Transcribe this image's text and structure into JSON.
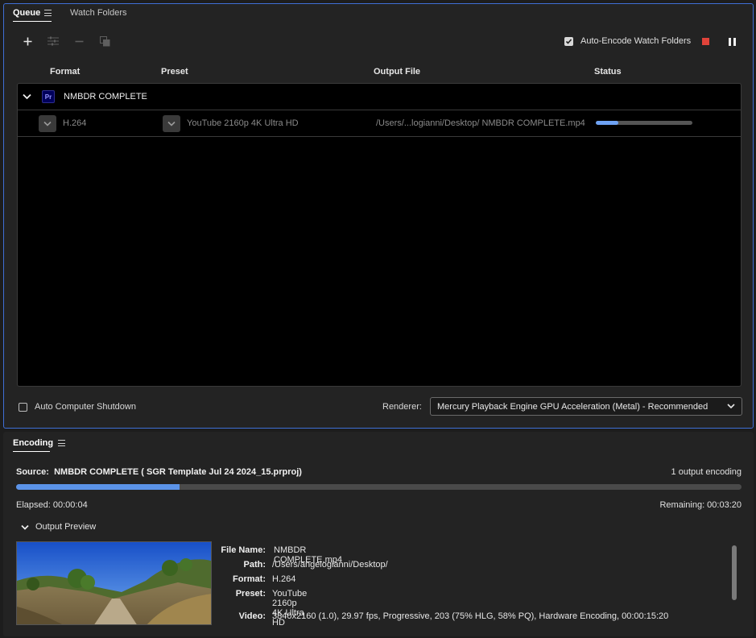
{
  "tabs": [
    {
      "label": "Queue",
      "active": true
    },
    {
      "label": "Watch Folders",
      "active": false
    }
  ],
  "toolbar": {
    "add_icon": "plus-icon",
    "settings_icon": "sliders-icon",
    "remove_icon": "minus-icon",
    "duplicate_icon": "duplicate-icon",
    "auto_encode_label": "Auto-Encode Watch Folders",
    "auto_encode_checked": true,
    "stop_color": "#e0433a"
  },
  "columns": {
    "format": "Format",
    "preset": "Preset",
    "output": "Output File",
    "status": "Status"
  },
  "queue": {
    "group_name": "NMBDR COMPLETE",
    "badge": "Pr",
    "item": {
      "format": "H.264",
      "preset": "YouTube 2160p 4K Ultra HD",
      "output": "/Users/...logianni/Desktop/ NMBDR COMPLETE.mp4",
      "progress": 0.23
    }
  },
  "bottom": {
    "auto_shutdown_label": "Auto Computer Shutdown",
    "renderer_label": "Renderer:",
    "renderer_value": "Mercury Playback Engine GPU Acceleration (Metal) - Recommended"
  },
  "encoding": {
    "title": "Encoding",
    "source_label": "Source:",
    "source_value": "NMBDR COMPLETE ( SGR Template Jul 24 2024_15.prproj)",
    "output_count": "1 output encoding",
    "progress": 0.225,
    "elapsed": "Elapsed: 00:00:04",
    "remaining": "Remaining: 00:03:20",
    "preview_label": "Output Preview",
    "details": {
      "file_name_key": "File Name:",
      "file_name": "NMBDR COMPLETE.mp4",
      "path_key": "Path:",
      "path": "/Users/angelogianni/Desktop/",
      "format_key": "Format:",
      "format": "H.264",
      "preset_key": "Preset:",
      "preset": "YouTube 2160p 4K Ultra HD",
      "video_key": "Video:",
      "video": "3840x2160 (1.0), 29.97 fps, Progressive, 203 (75% HLG, 58% PQ), Hardware Encoding, 00:00:15:20"
    }
  },
  "colors": {
    "accent": "#5b93e8",
    "panel_border": "#3f6fd6"
  }
}
